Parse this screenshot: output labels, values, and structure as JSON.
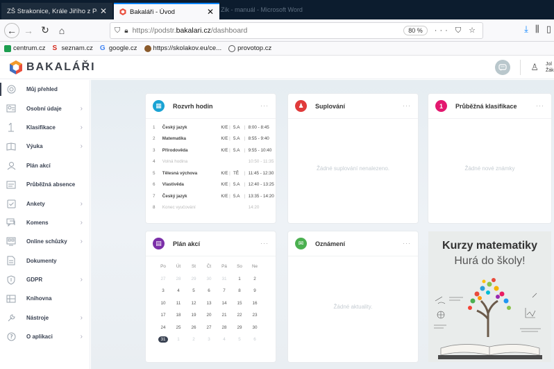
{
  "browser": {
    "tabs": [
      {
        "label": "ZŠ Strakonice, Krále Jiřího z Poděbr",
        "active": false
      },
      {
        "label": "Bakaláři - Úvod",
        "active": true
      }
    ],
    "background_window_title": "Zik - manuál - Microsoft Word",
    "url_prefix": "https://podstr.",
    "url_domain": "bakalari.cz",
    "url_path": "/dashboard",
    "zoom": "80 %",
    "bookmarks": [
      "centrum.cz",
      "seznam.cz",
      "google.cz",
      "https://skolakov.eu/ce...",
      "provotop.cz"
    ]
  },
  "app": {
    "brand": "BAKALÁŘI",
    "username_short": "Jol Žák",
    "sidebar": [
      {
        "label": "Můj přehled",
        "icon": "dashboard-icon",
        "chevron": false,
        "active": true
      },
      {
        "label": "Osobní údaje",
        "icon": "person-card-icon",
        "chevron": true
      },
      {
        "label": "Klasifikace",
        "icon": "grade-icon",
        "chevron": true
      },
      {
        "label": "Výuka",
        "icon": "book-icon",
        "chevron": true
      },
      {
        "label": "Plán akcí",
        "icon": "calendar-person-icon",
        "chevron": false
      },
      {
        "label": "Průběžná absence",
        "icon": "absence-icon",
        "chevron": false
      },
      {
        "label": "Ankety",
        "icon": "poll-icon",
        "chevron": true
      },
      {
        "label": "Komens",
        "icon": "chat-icon",
        "chevron": true
      },
      {
        "label": "Online schůzky",
        "icon": "video-meeting-icon",
        "chevron": true
      },
      {
        "label": "Dokumenty",
        "icon": "document-icon",
        "chevron": false
      },
      {
        "label": "GDPR",
        "icon": "shield-icon",
        "chevron": true
      },
      {
        "label": "Knihovna",
        "icon": "library-icon",
        "chevron": false
      },
      {
        "label": "Nástroje",
        "icon": "tools-icon",
        "chevron": true
      },
      {
        "label": "O aplikaci",
        "icon": "help-icon",
        "chevron": true
      }
    ],
    "cards": {
      "timetable": {
        "title": "Rozvrh hodin",
        "color": "#1aa3d4",
        "rows": [
          {
            "num": "1",
            "subject": "Český jazyk",
            "teacher": "K/E",
            "room": "5.A",
            "time": "8:00 - 8:45",
            "type": "lesson"
          },
          {
            "num": "2",
            "subject": "Matematika",
            "teacher": "K/E",
            "room": "5.A",
            "time": "8:55 - 9:40",
            "type": "lesson"
          },
          {
            "num": "3",
            "subject": "Přírodověda",
            "teacher": "K/E",
            "room": "5.A",
            "time": "9:55 - 10:40",
            "type": "lesson"
          },
          {
            "num": "4",
            "subject": "Volná hodina",
            "teacher": "",
            "room": "",
            "time": "10:50 - 11:35",
            "type": "free"
          },
          {
            "num": "5",
            "subject": "Tělesná výchova",
            "teacher": "K/E",
            "room": "TĚ",
            "time": "11:45 - 12:30",
            "type": "lesson"
          },
          {
            "num": "6",
            "subject": "Vlastivěda",
            "teacher": "K/E",
            "room": "5.A",
            "time": "12:40 - 13:25",
            "type": "lesson"
          },
          {
            "num": "7",
            "subject": "Český jazyk",
            "teacher": "K/E",
            "room": "5.A",
            "time": "13:35 - 14:20",
            "type": "lesson"
          },
          {
            "num": "8",
            "subject": "Konec vyučování",
            "teacher": "",
            "room": "",
            "time": "14:20",
            "type": "end"
          }
        ]
      },
      "substitutions": {
        "title": "Suplování",
        "color": "#e03b3b",
        "empty": "Žádné suplování nenalezeno."
      },
      "grades": {
        "title": "Průběžná klasifikace",
        "color": "#e3186f",
        "empty": "Žádné nové známky"
      },
      "events": {
        "title": "Plán akcí",
        "color": "#7b2fa8",
        "weekdays": [
          "Po",
          "Út",
          "St",
          "Čt",
          "Pá",
          "So",
          "Ne"
        ],
        "weeks": [
          [
            {
              "d": "27",
              "dim": true
            },
            {
              "d": "28",
              "dim": true
            },
            {
              "d": "29",
              "dim": true
            },
            {
              "d": "30",
              "dim": true
            },
            {
              "d": "31",
              "dim": true
            },
            {
              "d": "1"
            },
            {
              "d": "2"
            }
          ],
          [
            {
              "d": "3"
            },
            {
              "d": "4"
            },
            {
              "d": "5"
            },
            {
              "d": "6"
            },
            {
              "d": "7"
            },
            {
              "d": "8"
            },
            {
              "d": "9"
            }
          ],
          [
            {
              "d": "10"
            },
            {
              "d": "11"
            },
            {
              "d": "12"
            },
            {
              "d": "13"
            },
            {
              "d": "14"
            },
            {
              "d": "15"
            },
            {
              "d": "16"
            }
          ],
          [
            {
              "d": "17"
            },
            {
              "d": "18"
            },
            {
              "d": "19"
            },
            {
              "d": "20"
            },
            {
              "d": "21"
            },
            {
              "d": "22"
            },
            {
              "d": "23"
            }
          ],
          [
            {
              "d": "24"
            },
            {
              "d": "25"
            },
            {
              "d": "26"
            },
            {
              "d": "27"
            },
            {
              "d": "28"
            },
            {
              "d": "29"
            },
            {
              "d": "30"
            }
          ],
          [
            {
              "d": "31",
              "today": true
            },
            {
              "d": "1",
              "dim": true
            },
            {
              "d": "2",
              "dim": true
            },
            {
              "d": "3",
              "dim": true
            },
            {
              "d": "4",
              "dim": true
            },
            {
              "d": "5",
              "dim": true
            },
            {
              "d": "6",
              "dim": true
            }
          ]
        ]
      },
      "notices": {
        "title": "Oznámení",
        "color": "#4bb050",
        "empty": "Žádné aktuality."
      },
      "promo": {
        "line1": "Kurzy matematiky",
        "line2": "Hurá do školy!"
      }
    }
  }
}
